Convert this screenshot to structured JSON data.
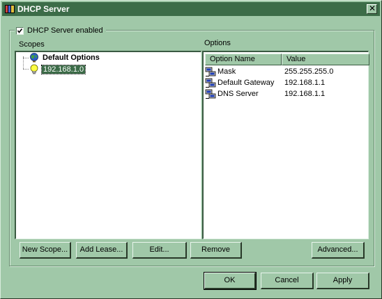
{
  "window": {
    "title": "DHCP Server",
    "title_icon": "dhcp-app-icon",
    "close_icon": "close-icon"
  },
  "server_enabled": {
    "label": "DHCP Server enabled",
    "checked": true
  },
  "scopes": {
    "label": "Scopes",
    "items": [
      {
        "label": "Default Options",
        "icon": "globe-icon",
        "bold": true
      },
      {
        "label": "192.168.1.0",
        "icon": "lightbulb-icon",
        "selected": true
      }
    ]
  },
  "options": {
    "label": "Options",
    "columns": [
      "Option Name",
      "Value"
    ],
    "rows": [
      {
        "name": "Mask",
        "value": "255.255.255.0",
        "icon": "network-option-icon"
      },
      {
        "name": "Default Gateway",
        "value": "192.168.1.1",
        "icon": "network-option-icon"
      },
      {
        "name": "DNS Server",
        "value": "192.168.1.1",
        "icon": "network-option-icon"
      }
    ]
  },
  "buttons": {
    "new_scope": "New Scope...",
    "add_lease": "Add Lease...",
    "edit": "Edit...",
    "remove": "Remove",
    "advanced": "Advanced...",
    "ok": "OK",
    "cancel": "Cancel",
    "apply": "Apply"
  },
  "colors": {
    "face": "#a0c8a8",
    "title_bar": "#3c6c48",
    "selection": "#3c6c48"
  }
}
